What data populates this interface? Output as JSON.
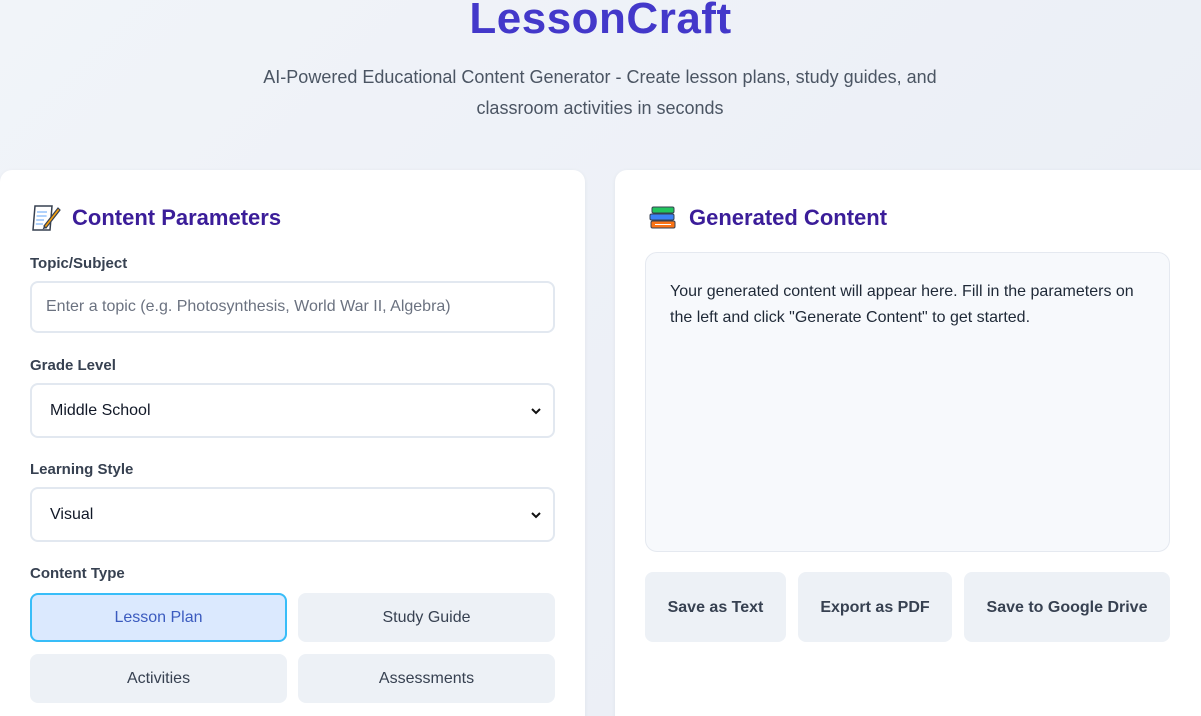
{
  "header": {
    "title": "LessonCraft",
    "subtitle": "AI-Powered Educational Content Generator - Create lesson plans, study guides, and classroom activities in seconds"
  },
  "parameters": {
    "title": "Content Parameters",
    "icon": "memo-icon",
    "topic": {
      "label": "Topic/Subject",
      "value": "",
      "placeholder": "Enter a topic (e.g. Photosynthesis, World War II, Algebra)"
    },
    "grade": {
      "label": "Grade Level",
      "selected": "Middle School"
    },
    "style": {
      "label": "Learning Style",
      "selected": "Visual"
    },
    "content_type": {
      "label": "Content Type",
      "options": [
        "Lesson Plan",
        "Study Guide",
        "Activities",
        "Assessments"
      ],
      "active": "Lesson Plan"
    }
  },
  "output": {
    "title": "Generated Content",
    "icon": "books-icon",
    "placeholder_text": "Your generated content will appear here. Fill in the parameters on the left and click \"Generate Content\" to get started.",
    "actions": [
      "Save as Text",
      "Export as PDF",
      "Save to Google Drive"
    ]
  },
  "colors": {
    "brand": "#4338ca",
    "heading": "#3b1d99",
    "active_bg": "#dbe9fe",
    "active_border": "#38bdf8"
  }
}
